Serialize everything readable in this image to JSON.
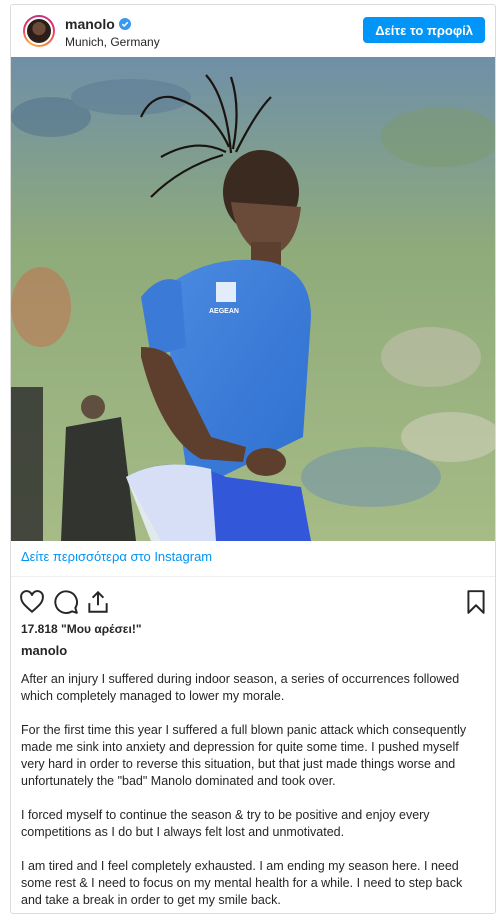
{
  "header": {
    "username": "manolo",
    "location": "Munich, Germany",
    "profile_button": "Δείτε το προφίλ"
  },
  "post": {
    "see_more_link": "Δείτε περισσότερα στο Instagram",
    "likes_text": "17.818 \"Μου αρέσει!\"",
    "caption_username": "manolo",
    "caption_paragraphs": [
      "After an injury I suffered during indoor season, a series of occurrences followed which completely managed to lower my morale.",
      "For the first time this year I suffered a full blown panic attack which consequently made me sink into anxiety and depression for quite some time. I pushed myself very hard in order to reverse this situation, but that just made things worse and unfortunately the \"bad\" Manolo dominated and took over.",
      "I forced myself to continue the season & try to be positive and enjoy every competitions as I do but I always felt lost and unmotivated.",
      "I am tired and I feel completely exhausted. I am ending my season here. I need some rest & I need to focus on my mental health for a while. I need to step back and take a break in order to get my smile back."
    ],
    "shirt_logo": "AEGEAN"
  },
  "icons": {
    "verified": "verified-badge-icon",
    "like": "heart-icon",
    "comment": "comment-icon",
    "share": "share-icon",
    "save": "bookmark-icon"
  },
  "colors": {
    "accent": "#0095f6",
    "text": "#262626",
    "border": "#dbdbdb"
  }
}
